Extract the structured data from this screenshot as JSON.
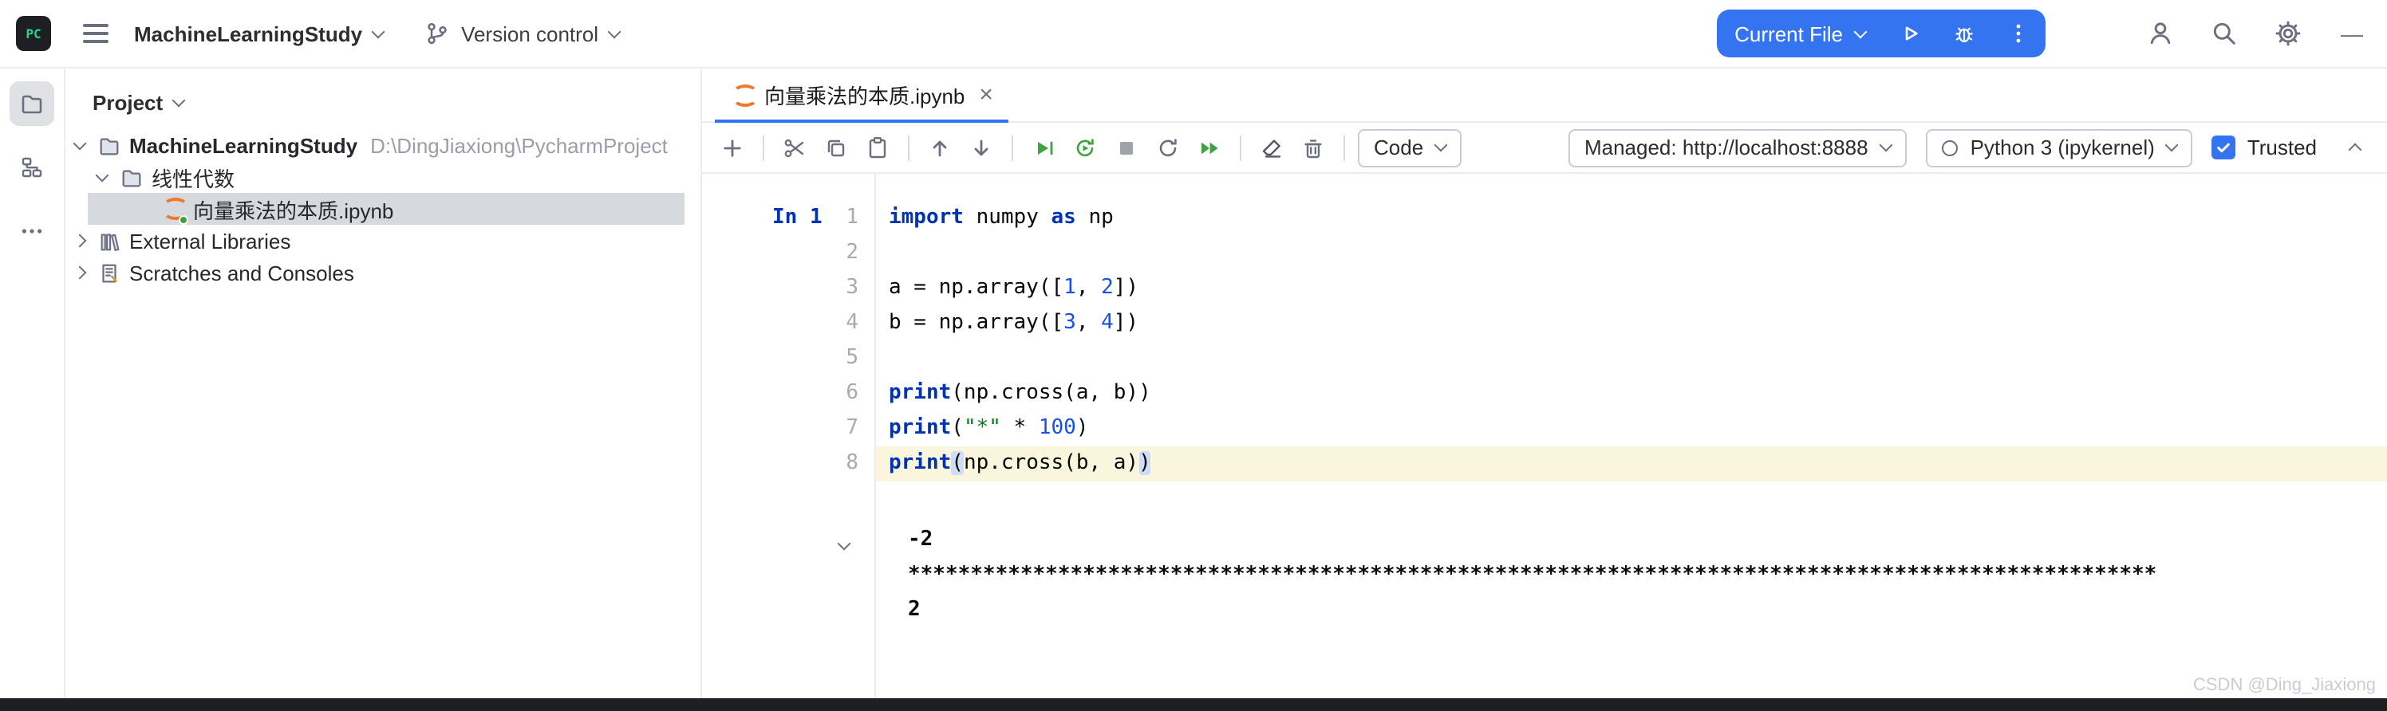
{
  "header": {
    "logo_text": "PC",
    "project_title": "MachineLearningStudy",
    "vcs_label": "Version control",
    "run_config": "Current File",
    "minimize_glyph": "—"
  },
  "project": {
    "title": "Project",
    "root": "MachineLearningStudy",
    "root_path": "D:\\DingJiaxiong\\PycharmProject",
    "subfolder": "线性代数",
    "notebook": "向量乘法的本质.ipynb",
    "external_libraries": "External Libraries",
    "scratches": "Scratches and Consoles"
  },
  "editor": {
    "tab_title": "向量乘法的本质.ipynb",
    "close_glyph": "×",
    "toolbar": {
      "cell_type": "Code",
      "server": "Managed: http://localhost:8888",
      "kernel": "Python 3 (ipykernel)",
      "trusted": "Trusted"
    },
    "cell": {
      "exec_label": "In 1",
      "active_line": 7,
      "lines": [
        [
          {
            "c": "k",
            "t": "import"
          },
          {
            "c": "p",
            "t": " numpy "
          },
          {
            "c": "k",
            "t": "as"
          },
          {
            "c": "p",
            "t": " np"
          }
        ],
        [],
        [
          {
            "c": "p",
            "t": "a = np.array(["
          },
          {
            "c": "n",
            "t": "1"
          },
          {
            "c": "p",
            "t": ", "
          },
          {
            "c": "n",
            "t": "2"
          },
          {
            "c": "p",
            "t": "])"
          }
        ],
        [
          {
            "c": "p",
            "t": "b = np.array(["
          },
          {
            "c": "n",
            "t": "3"
          },
          {
            "c": "p",
            "t": ", "
          },
          {
            "c": "n",
            "t": "4"
          },
          {
            "c": "p",
            "t": "])"
          }
        ],
        [],
        [
          {
            "c": "k",
            "t": "print"
          },
          {
            "c": "p",
            "t": "(np.cross(a, b))"
          }
        ],
        [
          {
            "c": "k",
            "t": "print"
          },
          {
            "c": "p",
            "t": "("
          },
          {
            "c": "s",
            "t": "\"*\""
          },
          {
            "c": "p",
            "t": " * "
          },
          {
            "c": "n",
            "t": "100"
          },
          {
            "c": "p",
            "t": ")"
          }
        ],
        [
          {
            "c": "k",
            "t": "print"
          },
          {
            "c": "m",
            "t": "("
          },
          {
            "c": "p",
            "t": "np.cross(b, a)"
          },
          {
            "c": "m",
            "t": ")"
          }
        ]
      ]
    },
    "output_lines": [
      "-2",
      "****************************************************************************************************",
      "2"
    ]
  },
  "watermark": "CSDN @Ding_Jiaxiong"
}
